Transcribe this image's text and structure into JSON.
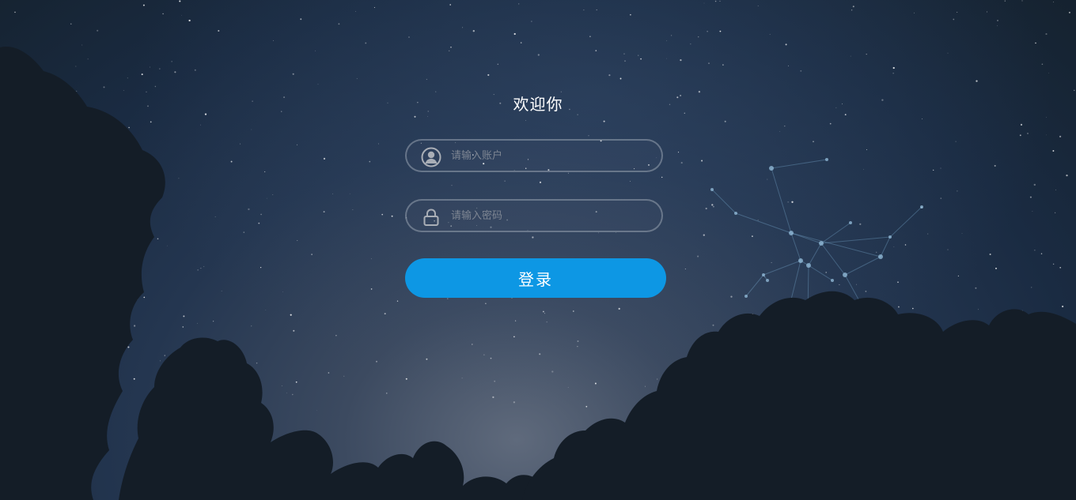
{
  "login": {
    "title": "欢迎你",
    "username": {
      "placeholder": "请输入账户",
      "value": "",
      "icon": "user-icon"
    },
    "password": {
      "placeholder": "请输入密码",
      "value": "",
      "icon": "lock-icon"
    },
    "submit_label": "登录"
  },
  "colors": {
    "accent": "#0d97e4",
    "sky_dark": "#15222f",
    "tree_silhouette": "#141d27",
    "field_border": "#96a0af"
  }
}
